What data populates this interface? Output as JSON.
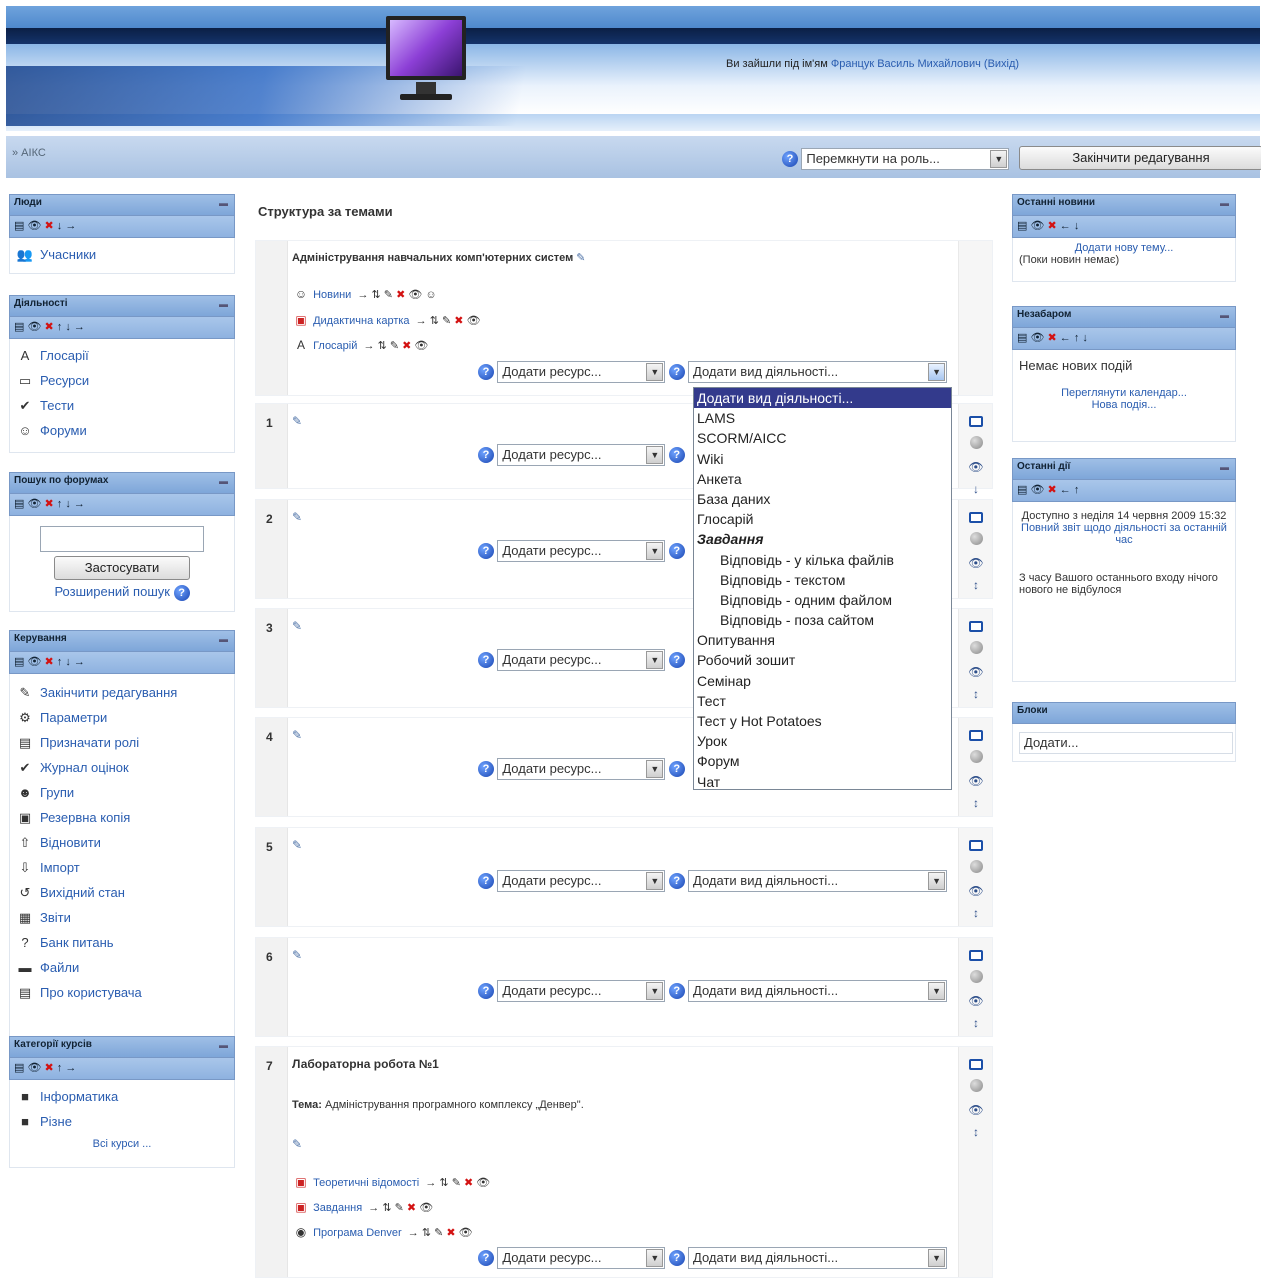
{
  "header": {
    "login_prefix": "Ви зайшли під ім'ям",
    "user_name": "Францук Василь Михайлович",
    "logout": "(Вихід)"
  },
  "navbar": {
    "breadcrumb": "» АІКС",
    "switch_role": "Перемкнути на роль...",
    "finish_editing": "Закінчити редагування"
  },
  "left_blocks": {
    "people": {
      "title": "Люди",
      "items": [
        {
          "label": "Учасники",
          "icon": "users-icon"
        }
      ]
    },
    "activities": {
      "title": "Діяльності",
      "items": [
        {
          "label": "Глосарії",
          "icon": "glossary-icon"
        },
        {
          "label": "Ресурси",
          "icon": "resource-icon"
        },
        {
          "label": "Тести",
          "icon": "quiz-icon"
        },
        {
          "label": "Форуми",
          "icon": "forum-icon"
        }
      ]
    },
    "search_forums": {
      "title": "Пошук по форумах",
      "input_value": "",
      "apply": "Застосувати",
      "advanced": "Розширений пошук"
    },
    "admin": {
      "title": "Керування",
      "items": [
        {
          "label": "Закінчити редагування",
          "icon": "edit-icon"
        },
        {
          "label": "Параметри",
          "icon": "settings-icon"
        },
        {
          "label": "Призначати ролі",
          "icon": "roles-icon"
        },
        {
          "label": "Журнал оцінок",
          "icon": "grades-icon"
        },
        {
          "label": "Групи",
          "icon": "groups-icon"
        },
        {
          "label": "Резервна копія",
          "icon": "backup-icon"
        },
        {
          "label": "Відновити",
          "icon": "restore-icon"
        },
        {
          "label": "Імпорт",
          "icon": "import-icon"
        },
        {
          "label": "Вихідний стан",
          "icon": "reset-icon"
        },
        {
          "label": "Звіти",
          "icon": "reports-icon"
        },
        {
          "label": "Банк питань",
          "icon": "question-bank-icon"
        },
        {
          "label": "Файли",
          "icon": "files-icon"
        },
        {
          "label": "Про користувача",
          "icon": "profile-icon"
        }
      ]
    },
    "categories": {
      "title": "Категорії курсів",
      "items": [
        {
          "label": "Інформатика"
        },
        {
          "label": "Різне"
        }
      ],
      "all_courses": "Всі курси ..."
    }
  },
  "main": {
    "title": "Структура за темами",
    "section0": {
      "title": "Адміністрування навчальних комп'ютерних систем",
      "resources": [
        {
          "label": "Новини",
          "icon": "forum-icon"
        },
        {
          "label": "Дидактична картка",
          "icon": "pdf-icon"
        },
        {
          "label": "Глосарій",
          "icon": "glossary-icon"
        }
      ]
    },
    "section_numbers": [
      "1",
      "2",
      "3",
      "4",
      "5",
      "6",
      "7"
    ],
    "section7": {
      "title": "Лабораторна робота №1",
      "topic_label": "Тема:",
      "topic_text": "Адміністрування програмного комплексу „Денвер\".",
      "resources": [
        {
          "label": "Теоретичні відомості",
          "icon": "pdf-icon"
        },
        {
          "label": "Завдання",
          "icon": "pdf-icon"
        },
        {
          "label": "Програма Denver",
          "icon": "web-icon"
        }
      ]
    },
    "add_resource": "Додати ресурс...",
    "add_activity": "Додати вид діяльності...",
    "activity_options": [
      {
        "label": "Додати вид діяльності...",
        "kind": "selected"
      },
      {
        "label": "LAMS",
        "kind": "normal"
      },
      {
        "label": "SCORM/AICC",
        "kind": "normal"
      },
      {
        "label": "Wiki",
        "kind": "normal"
      },
      {
        "label": "Анкета",
        "kind": "normal"
      },
      {
        "label": "База даних",
        "kind": "normal"
      },
      {
        "label": "Глосарій",
        "kind": "normal"
      },
      {
        "label": "Завдання",
        "kind": "group"
      },
      {
        "label": "Відповідь - у кілька файлів",
        "kind": "sub"
      },
      {
        "label": "Відповідь - текстом",
        "kind": "sub"
      },
      {
        "label": "Відповідь - одним файлом",
        "kind": "sub"
      },
      {
        "label": "Відповідь - поза сайтом",
        "kind": "sub"
      },
      {
        "label": "Опитування",
        "kind": "normal"
      },
      {
        "label": "Робочий зошит",
        "kind": "normal"
      },
      {
        "label": "Семінар",
        "kind": "normal"
      },
      {
        "label": "Тест",
        "kind": "normal"
      },
      {
        "label": "Тест у Hot Potatoes",
        "kind": "normal"
      },
      {
        "label": "Урок",
        "kind": "normal"
      },
      {
        "label": "Форум",
        "kind": "normal"
      },
      {
        "label": "Чат",
        "kind": "normal"
      }
    ]
  },
  "right_blocks": {
    "news": {
      "title": "Останні новини",
      "add_topic": "Додати нову тему...",
      "empty": "(Поки новин немає)"
    },
    "calendar": {
      "title": "Незабаром",
      "empty": "Немає нових подій",
      "go_calendar": "Переглянути календар...",
      "new_event": "Нова подія..."
    },
    "recent": {
      "title": "Останні дії",
      "since": "Доступно з неділя 14 червня 2009 15:32",
      "full_report": "Повний звіт щодо діяльності за останній час",
      "nothing": "З часу Вашого останнього входу нічого нового не відбулося"
    },
    "blocks": {
      "title": "Блоки",
      "add": "Додати..."
    }
  },
  "colors": {
    "accent": "#2a5db0",
    "delete": "#d31212",
    "block_header": "#8eb2e0"
  }
}
